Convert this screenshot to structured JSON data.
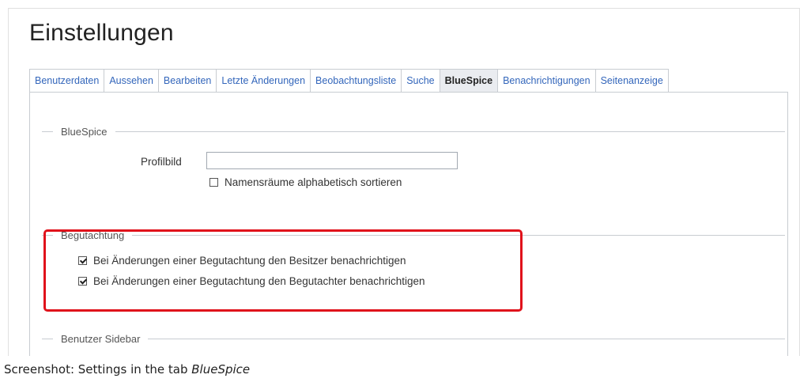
{
  "page": {
    "title": "Einstellungen"
  },
  "tabs": [
    {
      "label": "Benutzerdaten",
      "active": false
    },
    {
      "label": "Aussehen",
      "active": false
    },
    {
      "label": "Bearbeiten",
      "active": false
    },
    {
      "label": "Letzte Änderungen",
      "active": false
    },
    {
      "label": "Beobachtungsliste",
      "active": false
    },
    {
      "label": "Suche",
      "active": false
    },
    {
      "label": "BlueSpice",
      "active": true
    },
    {
      "label": "Benachrichtigungen",
      "active": false
    },
    {
      "label": "Seitenanzeige",
      "active": false
    }
  ],
  "sections": {
    "bluespice": {
      "legend": "BlueSpice",
      "profile_label": "Profilbild",
      "profile_value": "",
      "sort_label": "Namensräume alphabetisch sortieren",
      "sort_checked": false
    },
    "review": {
      "legend": "Begutachtung",
      "notify_owner_label": "Bei Änderungen einer Begutachtung den Besitzer benachrichtigen",
      "notify_owner_checked": true,
      "notify_reviewer_label": "Bei Änderungen einer Begutachtung den Begutachter benachrichtigen",
      "notify_reviewer_checked": true
    },
    "sidebar": {
      "legend": "Benutzer Sidebar"
    }
  },
  "caption": {
    "prefix": "Screenshot: Settings in the tab ",
    "emphasis": "BlueSpice"
  },
  "colors": {
    "highlight": "#e0121b",
    "link": "#3366bb",
    "active_tab_bg": "#eaecf0"
  }
}
